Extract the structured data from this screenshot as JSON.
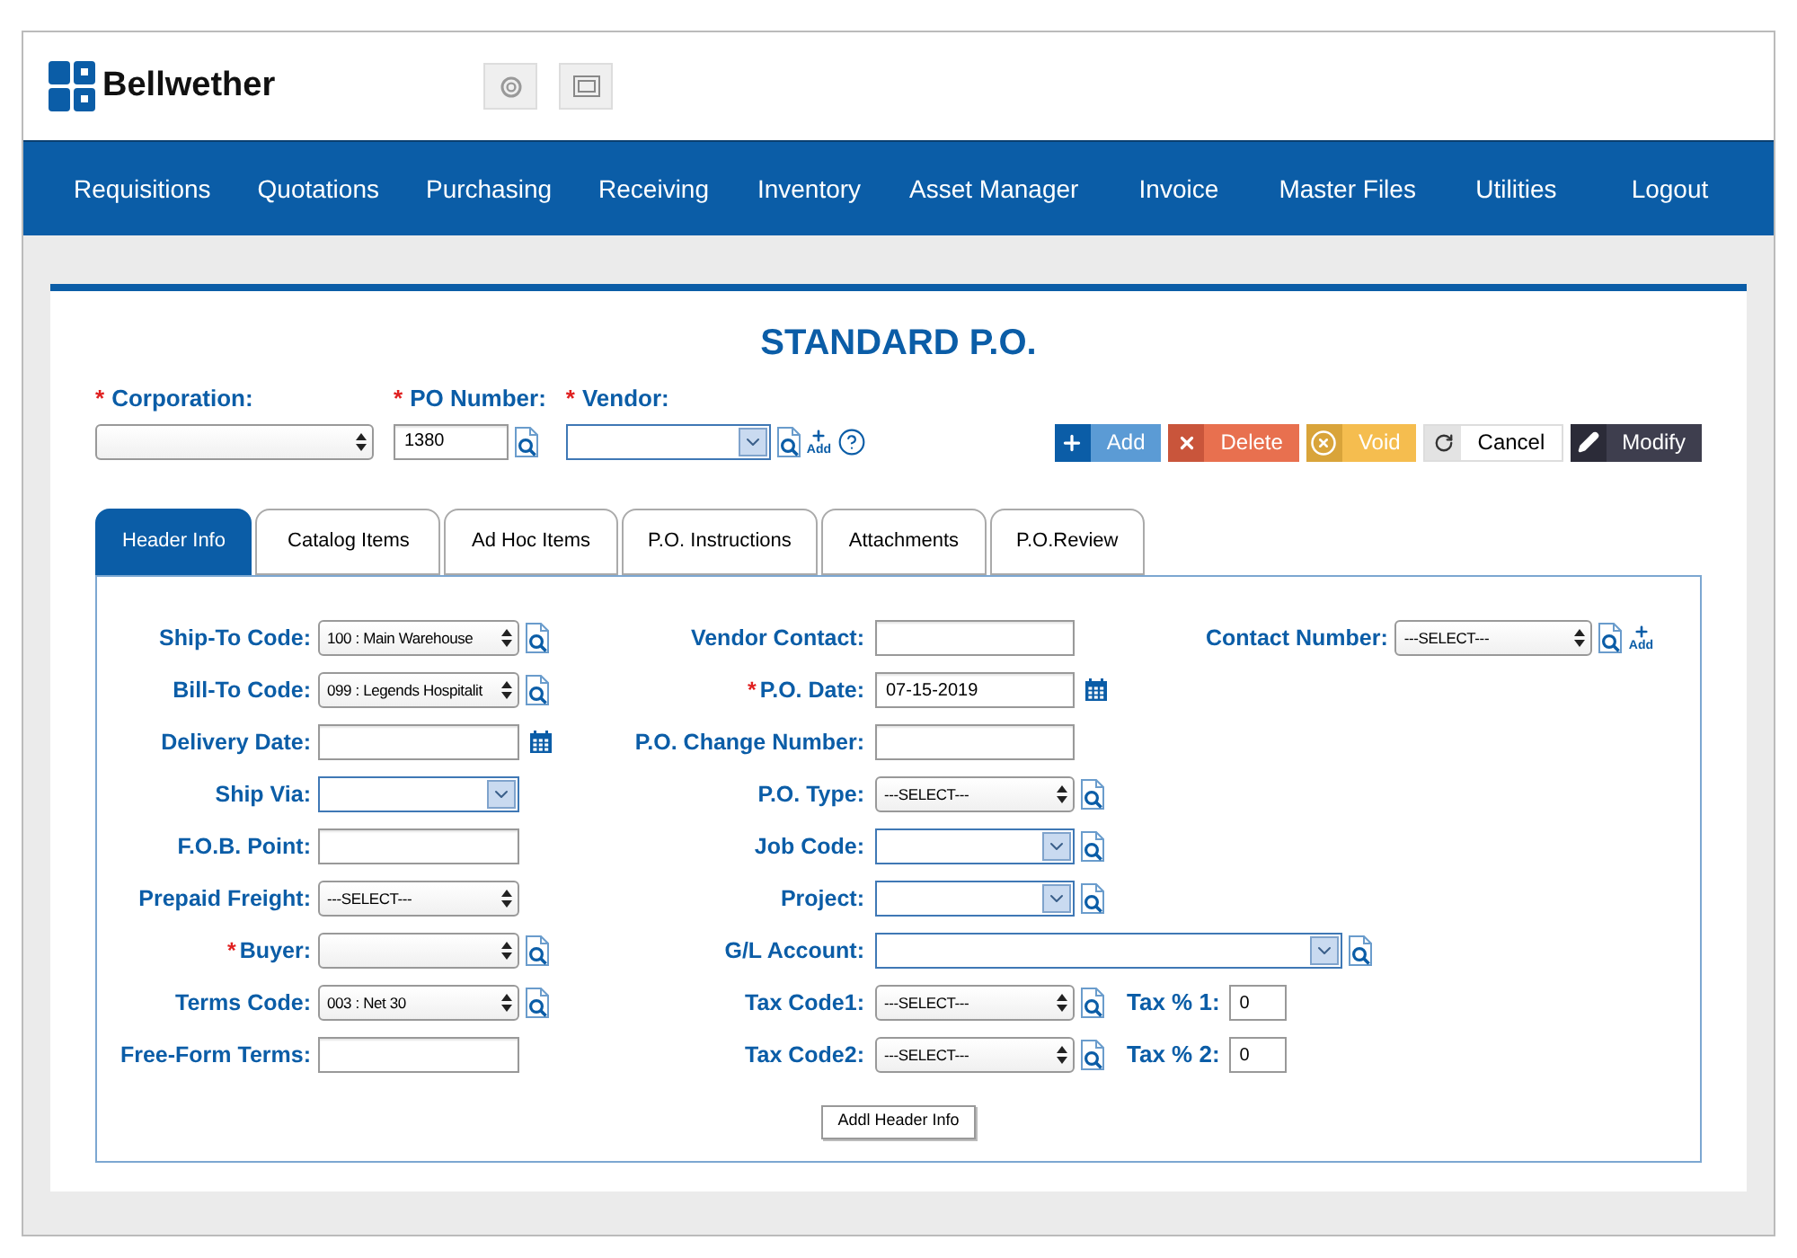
{
  "logo": "Bellwether",
  "nav": [
    "Requisitions",
    "Quotations",
    "Purchasing",
    "Receiving",
    "Inventory",
    "Asset Manager",
    "Invoice",
    "Master Files",
    "Utilities",
    "Logout"
  ],
  "page_title": "STANDARD P.O.",
  "top_fields": [
    {
      "label": "Corporation:",
      "required_mark": "*",
      "kind": "select"
    },
    {
      "label": "PO Number:",
      "required_mark": "*",
      "kind": "input",
      "value": "1380",
      "lookup": true
    },
    {
      "label": "Vendor:",
      "required_mark": "*",
      "kind": "combo",
      "lookup": true,
      "add": "Add",
      "help": true
    }
  ],
  "actions": [
    {
      "kind": "add",
      "label": "Add"
    },
    {
      "kind": "delete",
      "label": "Delete"
    },
    {
      "kind": "void",
      "label": "Void"
    },
    {
      "kind": "cancel",
      "label": "Cancel"
    },
    {
      "kind": "modify",
      "label": "Modify"
    }
  ],
  "tabs": [
    {
      "label": "Header Info",
      "selected": true
    },
    {
      "label": "Catalog Items",
      "selected": false
    },
    {
      "label": "Ad Hoc Items",
      "selected": false
    },
    {
      "label": "P.O. Instructions",
      "selected": false
    },
    {
      "label": "Attachments",
      "selected": false
    },
    {
      "label": "P.O.Review",
      "selected": false
    }
  ],
  "left_fields": [
    {
      "label": "Ship-To Code:",
      "kind": "select",
      "value": "100 : Main Warehouse",
      "lookup": true
    },
    {
      "label": "Bill-To Code:",
      "kind": "select",
      "value": "099 : Legends Hospitalit",
      "lookup": true
    },
    {
      "label": "Delivery Date:",
      "kind": "input",
      "calendar": true
    },
    {
      "label": "Ship Via:",
      "kind": "combo"
    },
    {
      "label": "F.O.B. Point:",
      "kind": "input"
    },
    {
      "label": "Prepaid Freight:",
      "kind": "select",
      "value": "---SELECT---"
    },
    {
      "label": "Buyer:",
      "required_mark": "*",
      "kind": "select",
      "lookup": true
    },
    {
      "label": "Terms Code:",
      "kind": "select",
      "value": "003 : Net 30",
      "lookup": true
    },
    {
      "label": "Free-Form Terms:",
      "kind": "input"
    }
  ],
  "middle_fields": [
    {
      "label": "Vendor Contact:",
      "kind": "input"
    },
    {
      "label": "P.O. Date:",
      "required_mark": "*",
      "kind": "input",
      "value": "07-15-2019",
      "calendar": true
    },
    {
      "label": "P.O. Change Number:",
      "kind": "input"
    },
    {
      "label": "P.O. Type:",
      "kind": "select",
      "value": "---SELECT---",
      "lookup": true
    },
    {
      "label": "Job Code:",
      "kind": "combo",
      "lookup": true
    },
    {
      "label": "Project:",
      "kind": "combo",
      "lookup": true
    },
    {
      "label": "G/L Account:",
      "kind": "combo_wide",
      "lookup": true
    },
    {
      "label": "Tax Code1:",
      "kind": "select",
      "value": "---SELECT---",
      "lookup": true,
      "tax": {
        "label": "Tax % 1:",
        "value": "0"
      }
    },
    {
      "label": "Tax Code2:",
      "kind": "select",
      "value": "---SELECT---",
      "lookup": true,
      "tax": {
        "label": "Tax % 2:",
        "value": "0"
      }
    }
  ],
  "contact": {
    "label": "Contact Number:",
    "kind": "select",
    "value": "---SELECT---",
    "lookup": true,
    "add": "Add"
  },
  "addl_button": "Addl Header Info"
}
